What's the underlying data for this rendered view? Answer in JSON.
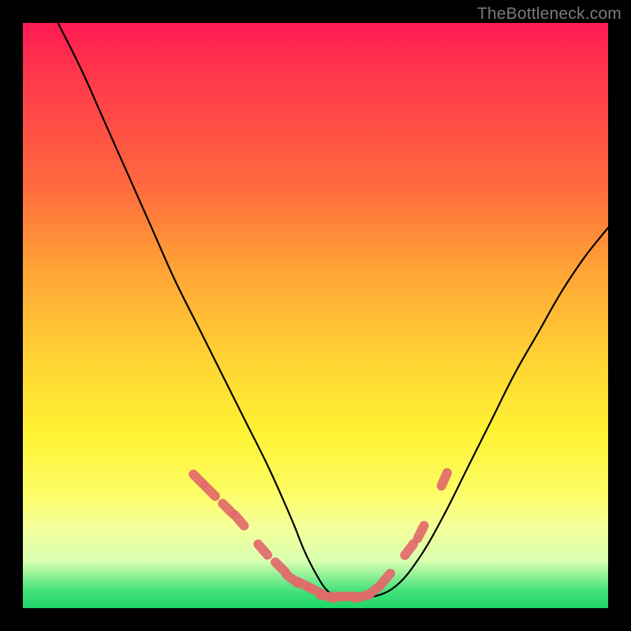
{
  "watermark": "TheBottleneck.com",
  "chart_data": {
    "type": "line",
    "title": "",
    "xlabel": "",
    "ylabel": "",
    "xlim": [
      0,
      100
    ],
    "ylim": [
      0,
      100
    ],
    "grid": false,
    "series": [
      {
        "name": "bottleneck-curve",
        "color": "#000000",
        "x": [
          6,
          10,
          14,
          18,
          22,
          26,
          30,
          34,
          38,
          42,
          46,
          48,
          50,
          52,
          54,
          56,
          60,
          64,
          68,
          72,
          76,
          80,
          84,
          88,
          92,
          96,
          100
        ],
        "y": [
          100,
          92,
          83,
          74,
          65,
          56,
          48,
          40,
          32,
          24,
          15,
          10,
          6,
          3,
          2,
          2,
          2,
          4,
          9,
          16,
          24,
          32,
          40,
          47,
          54,
          60,
          65
        ]
      },
      {
        "name": "highlight-dots",
        "color": "#e26a6a",
        "type": "scatter",
        "x": [
          30,
          32,
          35,
          37,
          41,
          44,
          46,
          48,
          50,
          52,
          54,
          56,
          58,
          60,
          62,
          66,
          68,
          72
        ],
        "y": [
          22,
          20,
          17,
          15,
          10,
          7,
          5,
          4,
          3,
          2,
          2,
          2,
          2,
          3,
          5,
          10,
          13,
          22
        ]
      }
    ]
  }
}
